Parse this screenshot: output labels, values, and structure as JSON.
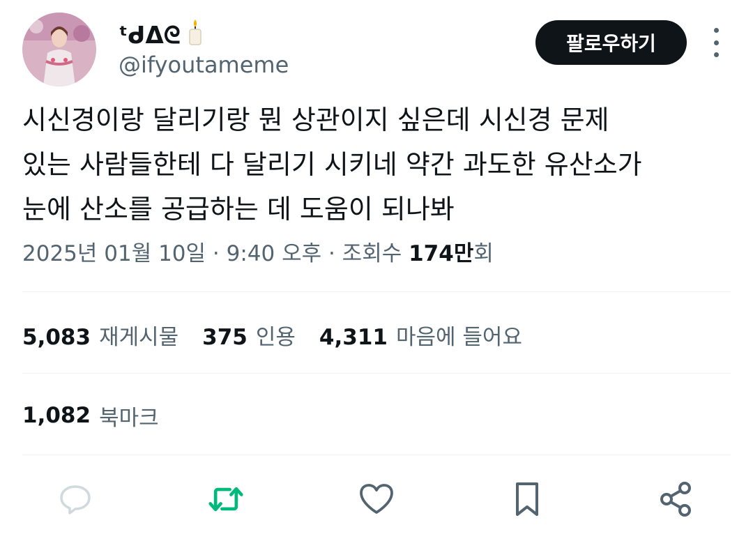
{
  "author": {
    "display_name": "ᵗᑯᐃᘓ",
    "handle": "@ifyoutameme",
    "avatar_icon": "avatar-portrait",
    "candle_emoji": "🕯️"
  },
  "follow_label": "팔로우하기",
  "tweet": {
    "lines": [
      "시신경이랑 달리기랑 뭔 상관이지 싶은데 시신경 문제",
      "있는 사람들한테 다 달리기 시키네 약간 과도한 유산소가",
      "눈에 산소를 공급하는 데 도움이 되나봐"
    ]
  },
  "meta": {
    "timestamp": "2025년 01월 10일 · 9:40 오후 · 조회수 ",
    "views_number": "174만",
    "views_suffix": "회"
  },
  "stats": {
    "retweets_count": "5,083",
    "retweets_label": "재게시물",
    "quotes_count": "375",
    "quotes_label": "인용",
    "likes_count": "4,311",
    "likes_label": "마음에 들어요",
    "bookmarks_count": "1,082",
    "bookmarks_label": "북마크"
  },
  "actions": [
    "reply-icon",
    "retweet-icon",
    "like-icon",
    "bookmark-icon",
    "share-icon"
  ],
  "colors": {
    "text": "#0f1419",
    "secondary": "#536471",
    "retweet_green": "#00ba7c",
    "reply_light": "#cfd9de",
    "divider": "#eff3f4"
  }
}
